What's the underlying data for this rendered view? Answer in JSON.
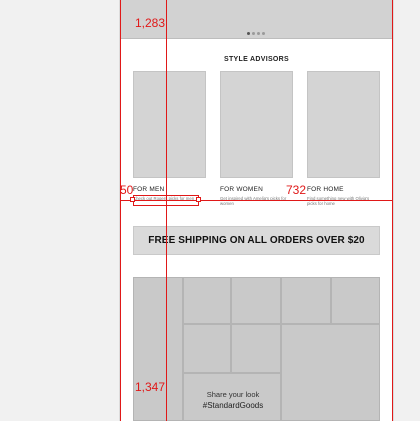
{
  "hero": {
    "carousel_dots": 4,
    "active_dot": 1
  },
  "style_advisors": {
    "title": "STYLE ADVISORS",
    "cards": [
      {
        "title": "FOR MEN",
        "desc": "Check out Rogers picks for men"
      },
      {
        "title": "FOR WOMEN",
        "desc": "Get inspired with Amelia's picks for women"
      },
      {
        "title": "FOR HOME",
        "desc": "Find something new with Olivia's picks for home"
      }
    ]
  },
  "promo_banner": {
    "text": "FREE SHIPPING ON ALL ORDERS OVER $20"
  },
  "social": {
    "line1": "Share your look",
    "hashtag": "#StandardGoods"
  },
  "overlay": {
    "color": "#e01818",
    "measurements": [
      "1,283",
      "50",
      "732",
      "1,347"
    ]
  },
  "colors": {
    "page_bg": "#f1f1f1",
    "placeholder": "#d4d4d4",
    "guide": "#e01818"
  }
}
